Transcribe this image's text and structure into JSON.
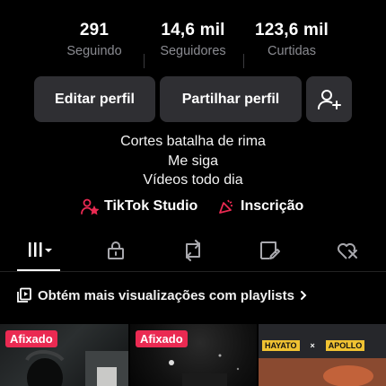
{
  "stats": [
    {
      "value": "291",
      "label": "Seguindo"
    },
    {
      "value": "14,6 mil",
      "label": "Seguidores"
    },
    {
      "value": "123,6 mil",
      "label": "Curtidas"
    }
  ],
  "actions": {
    "edit_profile": "Editar perfil",
    "share_profile": "Partilhar perfil"
  },
  "bio": [
    "Cortes batalha de rima",
    "Me siga",
    "Vídeos todo dia"
  ],
  "links": {
    "studio": "TikTok Studio",
    "subscription": "Inscrição"
  },
  "tabs": [
    {
      "icon": "grid-icon",
      "active": true
    },
    {
      "icon": "lock-icon"
    },
    {
      "icon": "repost-icon"
    },
    {
      "icon": "saved-icon"
    },
    {
      "icon": "liked-icon"
    }
  ],
  "playlist_prompt": "Obtém mais visualizações com playlists",
  "videos": [
    {
      "pinned_label": "Afixado"
    },
    {
      "pinned_label": "Afixado"
    },
    {
      "overlay_left": "HAYATO",
      "overlay_mid": "×",
      "overlay_right": "APOLLO"
    }
  ],
  "colors": {
    "background": "#000000",
    "button": "#2f2f33",
    "muted_text": "#8a8b91",
    "accent": "#ea2a52"
  }
}
